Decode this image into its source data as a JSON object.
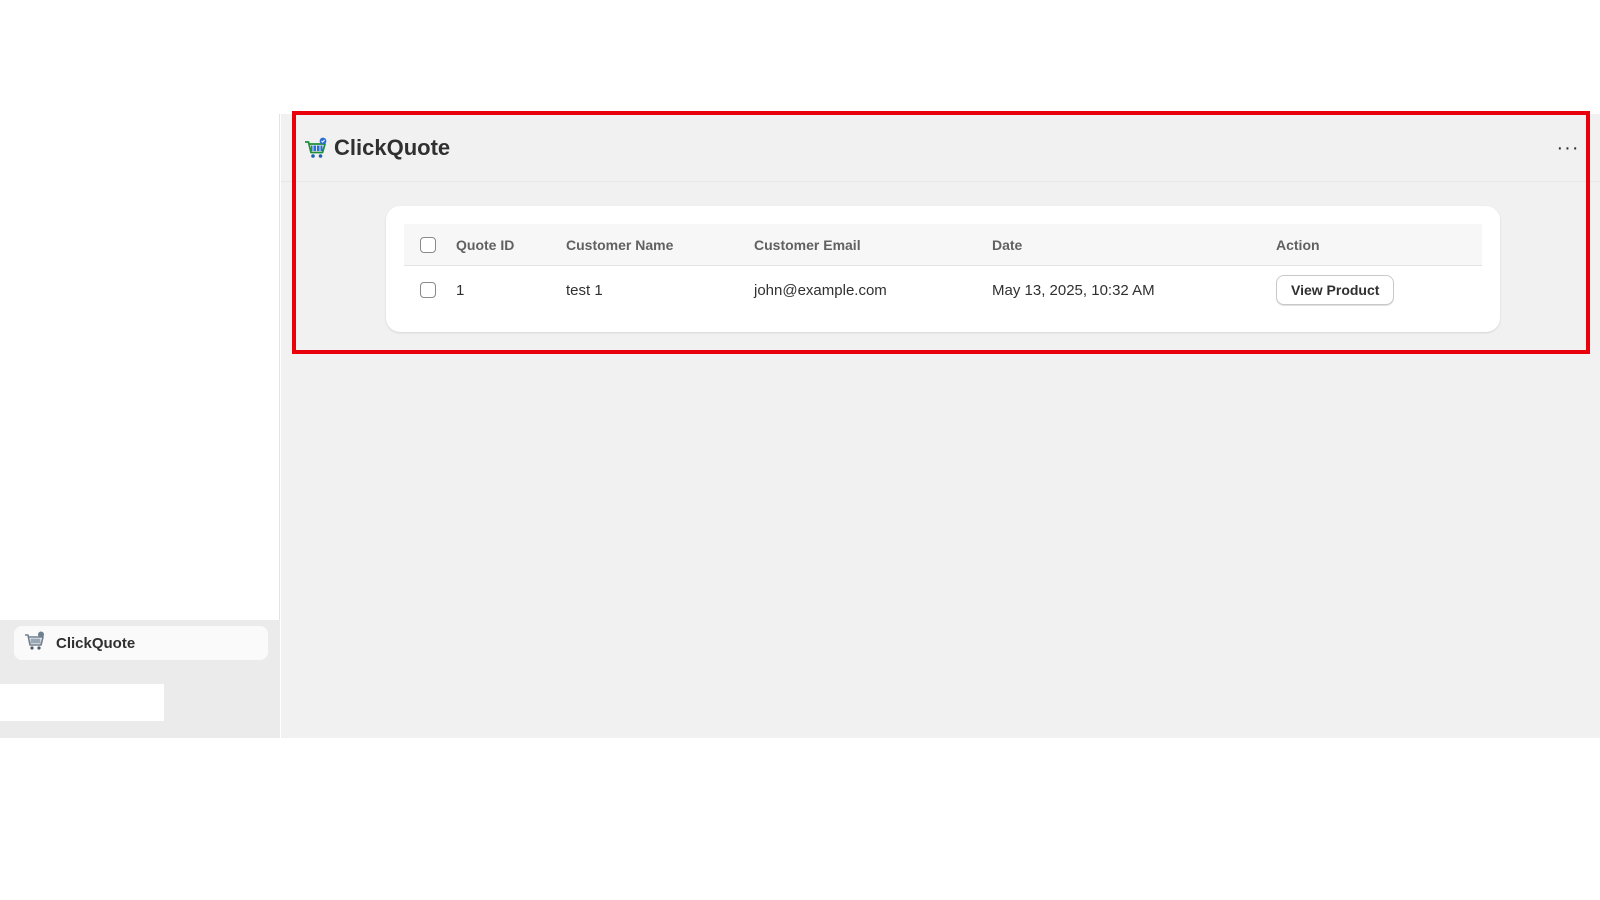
{
  "app": {
    "name": "ClickQuote",
    "logo_icon": "cart-logo-icon"
  },
  "sidebar": {
    "app_item": {
      "label": "ClickQuote",
      "icon": "cart-logo-icon"
    }
  },
  "header": {
    "title": "ClickQuote",
    "menu_label": "···"
  },
  "table": {
    "columns": [
      "Quote ID",
      "Customer Name",
      "Customer Email",
      "Date",
      "Action"
    ],
    "rows": [
      {
        "quote_id": "1",
        "customer_name": "test 1",
        "customer_email": "john@example.com",
        "date": "May 13, 2025, 10:32 AM",
        "action_label": "View Product"
      }
    ]
  },
  "colors": {
    "highlight": "#e8000b",
    "main_bg": "#f1f1f1",
    "card_bg": "#ffffff"
  }
}
